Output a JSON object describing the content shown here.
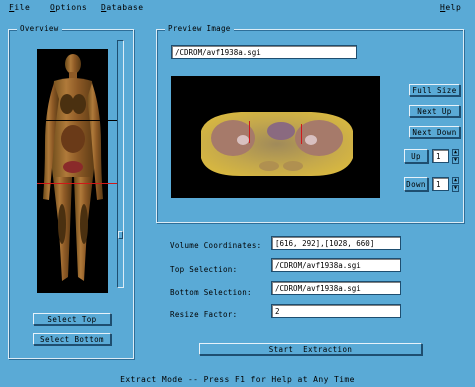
{
  "menu": {
    "file": {
      "ul": "F",
      "rest": "ile"
    },
    "options": {
      "ul": "O",
      "rest": "ptions"
    },
    "database": {
      "ul": "D",
      "rest": "atabase"
    },
    "help": {
      "ul": "H",
      "rest": "elp"
    }
  },
  "overview": {
    "title": "Overview",
    "select_top": "Select Top",
    "select_bottom": "Select Bottom",
    "slider_position": 0.8
  },
  "preview": {
    "title": "Preview Image",
    "path": "/CDROM/avf1938a.sgi",
    "full_size": "Full Size",
    "next_up": "Next Up",
    "next_down": "Next Down",
    "up_label": "Up",
    "up_value": "1",
    "down_label": "Down",
    "down_value": "1"
  },
  "form": {
    "volume_label": "Volume Coordinates:",
    "volume_value": "[616, 292],[1028, 660]",
    "top_label": "Top Selection:",
    "top_value": "/CDROM/avf1938a.sgi",
    "bottom_label": "Bottom Selection:",
    "bottom_value": "/CDROM/avf1938a.sgi",
    "resize_label": "Resize Factor:",
    "resize_value": "2",
    "start_button": "Start  Extraction"
  },
  "status": "Extract Mode -- Press F1 for Help at Any Time",
  "colors": {
    "background": "#5aaad6",
    "highlight": "#dcecf6",
    "shadow": "#1e4e70"
  }
}
